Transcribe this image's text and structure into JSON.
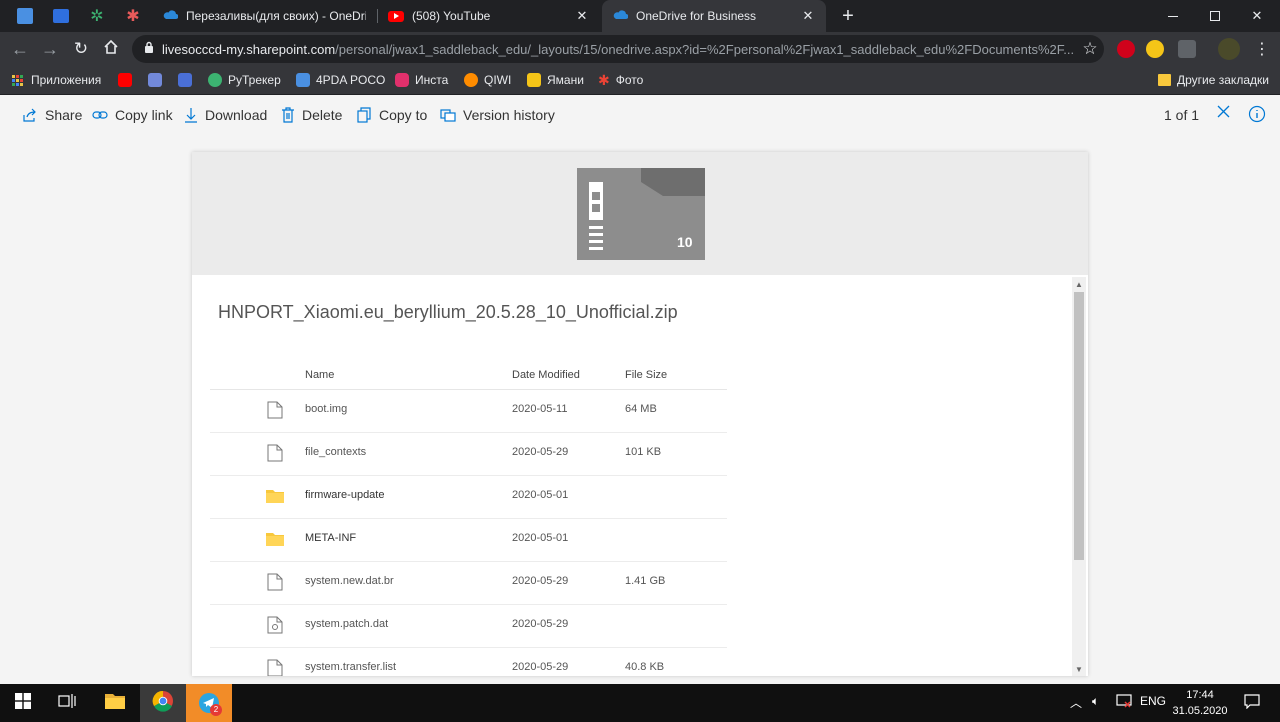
{
  "browser": {
    "tabs": [
      {
        "title": "Перезаливы(для своих) - OneDrive",
        "icon": "onedrive-icon"
      },
      {
        "title": "(508) YouTube",
        "icon": "youtube-icon"
      },
      {
        "title": "OneDrive for Business",
        "icon": "onedrive-icon",
        "active": true
      }
    ],
    "new_tab": "+",
    "url_host": "livesocccd-my.sharepoint.com",
    "url_path": "/personal/jwax1_saddleback_edu/_layouts/15/onedrive.aspx?id=%2Fpersonal%2Fjwax1_saddleback_edu%2FDocuments%2F...",
    "bookmarks": [
      {
        "label": "Приложения",
        "color": "#e8c547"
      },
      {
        "label": "",
        "color": "#ff0000"
      },
      {
        "label": "",
        "color": "#7289da"
      },
      {
        "label": "",
        "color": "#4a6fd6"
      },
      {
        "label": "РуТрекер",
        "color": "#3cb371"
      },
      {
        "label": "4PDA POCO",
        "color": "#4a90e2"
      },
      {
        "label": "Инста",
        "color": "#e1306c"
      },
      {
        "label": "QIWI",
        "color": "#ff8c00"
      },
      {
        "label": "Ямани",
        "color": "#f5c518"
      },
      {
        "label": "Фото",
        "color": "#ea4335"
      }
    ],
    "other_bookmarks": "Другие закладки"
  },
  "commands": {
    "share": "Share",
    "copy_link": "Copy link",
    "download": "Download",
    "delete": "Delete",
    "copy_to": "Copy to",
    "version_history": "Version history",
    "pager": "1 of 1"
  },
  "preview": {
    "badge": "10",
    "file_title": "HNPORT_Xiaomi.eu_beryllium_20.5.28_10_Unofficial.zip",
    "columns": {
      "name": "Name",
      "date": "Date Modified",
      "size": "File Size"
    },
    "rows": [
      {
        "type": "file",
        "name": "boot.img",
        "date": "2020-05-11",
        "size": "64 MB"
      },
      {
        "type": "file",
        "name": "file_contexts",
        "date": "2020-05-29",
        "size": "101 KB"
      },
      {
        "type": "folder",
        "name": "firmware-update",
        "date": "2020-05-01",
        "size": ""
      },
      {
        "type": "folder",
        "name": "META-INF",
        "date": "2020-05-01",
        "size": ""
      },
      {
        "type": "file",
        "name": "system.new.dat.br",
        "date": "2020-05-29",
        "size": "1.41 GB"
      },
      {
        "type": "settings-file",
        "name": "system.patch.dat",
        "date": "2020-05-29",
        "size": ""
      },
      {
        "type": "file",
        "name": "system.transfer.list",
        "date": "2020-05-29",
        "size": "40.8 KB"
      }
    ]
  },
  "taskbar": {
    "lang": "ENG",
    "time": "17:44",
    "date": "31.05.2020",
    "telegram_badge": "2"
  },
  "colors": {
    "accent": "#0078d4",
    "folder": "#f8c83c",
    "taskbar_highlight": "#f28c28"
  }
}
